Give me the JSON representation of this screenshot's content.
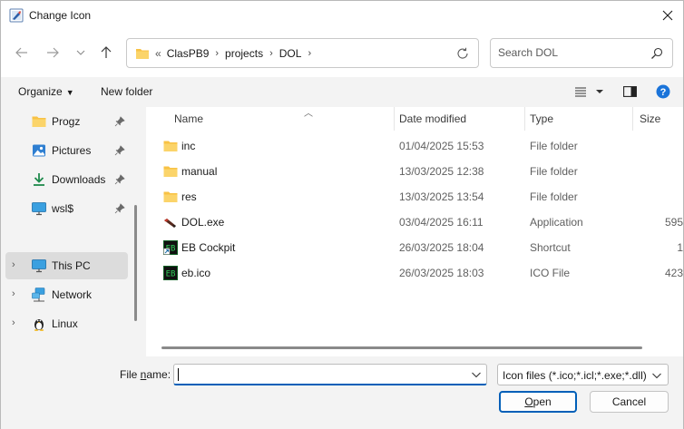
{
  "window": {
    "title": "Change Icon"
  },
  "address": {
    "overflow": "«",
    "crumbs": [
      "ClasPB9",
      "projects",
      "DOL"
    ]
  },
  "search": {
    "placeholder": "Search DOL"
  },
  "toolbar": {
    "organize": "Organize",
    "new_folder": "New folder"
  },
  "nav": {
    "quick": [
      {
        "label": "Progz",
        "icon": "folder-icon"
      },
      {
        "label": "Pictures",
        "icon": "pictures-icon"
      },
      {
        "label": "Downloads",
        "icon": "download-icon"
      },
      {
        "label": "wsl$",
        "icon": "monitor-icon"
      }
    ],
    "tree": [
      {
        "label": "This PC",
        "icon": "monitor-icon",
        "selected": true
      },
      {
        "label": "Network",
        "icon": "network-icon"
      },
      {
        "label": "Linux",
        "icon": "penguin-icon"
      }
    ]
  },
  "columns": {
    "name": "Name",
    "date": "Date modified",
    "type": "Type",
    "size": "Size"
  },
  "files": [
    {
      "name": "inc",
      "date": "01/04/2025 15:53",
      "type": "File folder",
      "size": "",
      "icon": "folder-icon"
    },
    {
      "name": "manual",
      "date": "13/03/2025 12:38",
      "type": "File folder",
      "size": "",
      "icon": "folder-icon"
    },
    {
      "name": "res",
      "date": "13/03/2025 13:54",
      "type": "File folder",
      "size": "",
      "icon": "folder-icon"
    },
    {
      "name": "DOL.exe",
      "date": "03/04/2025 16:11",
      "type": "Application",
      "size": "595",
      "icon": "exe-icon"
    },
    {
      "name": "EB Cockpit",
      "date": "26/03/2025 18:04",
      "type": "Shortcut",
      "size": "1",
      "icon": "shortcut-icon"
    },
    {
      "name": "eb.ico",
      "date": "26/03/2025 18:03",
      "type": "ICO File",
      "size": "423",
      "icon": "ico-icon"
    }
  ],
  "bottom": {
    "file_name_label_prefix": "File ",
    "file_name_label_underlined": "n",
    "file_name_label_suffix": "ame:",
    "file_name_value": "",
    "filter": "Icon files (*.ico;*.icl;*.exe;*.dll)",
    "open_underlined": "O",
    "open_rest": "pen",
    "cancel": "Cancel"
  },
  "colors": {
    "accent": "#005fb8",
    "folder": "#f8c244",
    "help": "#1a73d9"
  }
}
